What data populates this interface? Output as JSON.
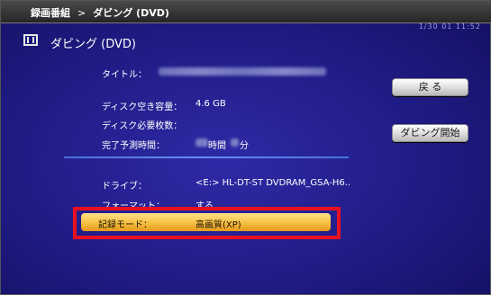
{
  "topbar": {
    "crumb_root": "録画番組",
    "crumb_sep": ">",
    "crumb_current": "ダビング (DVD)",
    "timestamp": "1/30 01 11:52"
  },
  "header": {
    "title": "ダビング (DVD)",
    "icon": "film-icon"
  },
  "info": {
    "title_label": "タイトル：",
    "disk_free_label": "ディスク空き容量：",
    "disk_free_value": "4.6 GB",
    "disk_needed_label": "ディスク必要枚数：",
    "finish_time_label": "完了予測時間：",
    "finish_time_value": "時間",
    "finish_time_unit": "分"
  },
  "options": {
    "drive_label": "ドライブ：",
    "drive_value": "<E:>  HL-DT-ST DVDRAM_GSA-H6..",
    "format_label": "フォーマット：",
    "format_value": "する",
    "mode_label": "記録モード：",
    "mode_value": "高画質(XP)"
  },
  "buttons": {
    "back": "戻 る",
    "start": "ダビング開始"
  },
  "colors": {
    "background": "#1f1b84",
    "highlight_bar": "#f7c347",
    "highlight_border": "#e8101e",
    "divider": "#4a6fe0"
  }
}
